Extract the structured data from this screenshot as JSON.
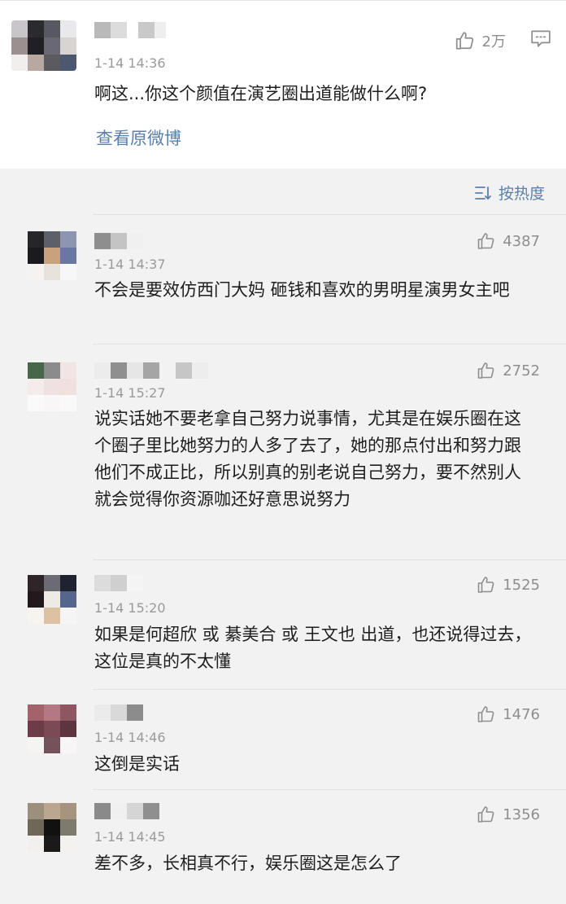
{
  "top_post": {
    "time": "1-14 14:36",
    "text": "啊这...你这个颜值在演艺圈出道能做什么啊?",
    "likes": "2万",
    "view_original": "查看原微博"
  },
  "sort_label": "按热度",
  "comments": [
    {
      "time": "1-14 14:37",
      "likes": "4387",
      "text": "不会是要效仿西门大妈 砸钱和喜欢的男明星演男女主吧"
    },
    {
      "time": "1-14 15:27",
      "likes": "2752",
      "text": "说实话她不要老拿自己努力说事情，尤其是在娱乐圈在这个圈子里比她努力的人多了去了，她的那点付出和努力跟他们不成正比，所以别真的别老说自己努力，要不然别人就会觉得你资源咖还好意思说努力"
    },
    {
      "time": "1-14 15:20",
      "likes": "1525",
      "text": "如果是何超欣 或 綦美合 或 王文也 出道，也还说得过去，这位是真的不太懂"
    },
    {
      "time": "1-14 14:46",
      "likes": "1476",
      "text": "这倒是实话"
    },
    {
      "time": "1-14 14:45",
      "likes": "1356",
      "text": "差不多，长相真不行，娱乐圈这是怎么了"
    }
  ],
  "icons": {
    "like": "thumbs-up-icon",
    "comment": "comment-bubble-icon",
    "sort": "sort-icon"
  },
  "colors": {
    "link": "#5b7fa8",
    "meta": "#9a9a9a",
    "background": "#f2f2f2"
  }
}
